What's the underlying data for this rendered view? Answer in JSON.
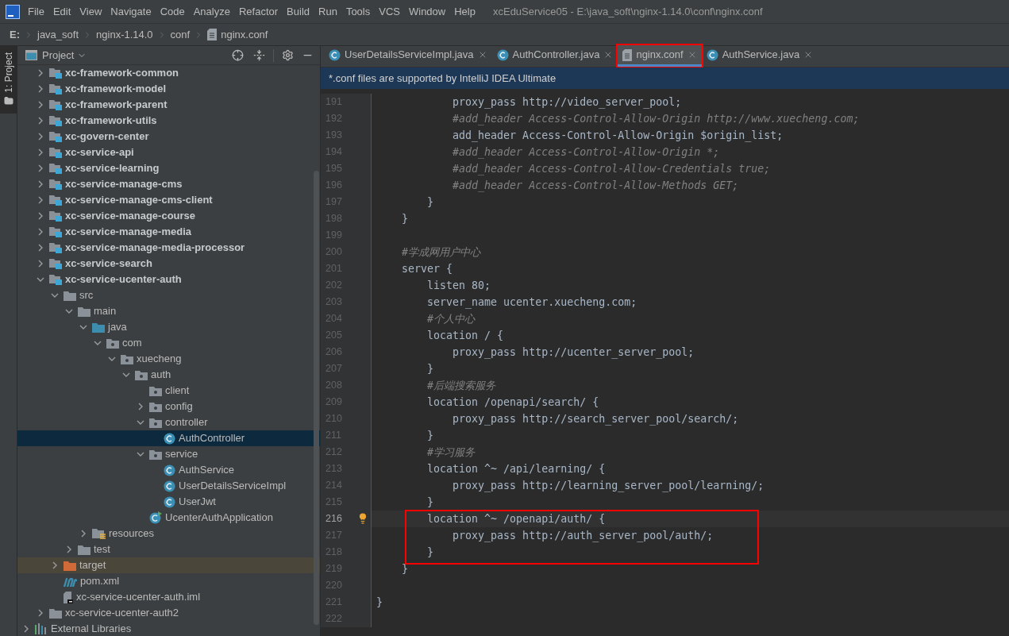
{
  "menu": {
    "items": [
      "File",
      "Edit",
      "View",
      "Navigate",
      "Code",
      "Analyze",
      "Refactor",
      "Build",
      "Run",
      "Tools",
      "VCS",
      "Window",
      "Help"
    ],
    "title": "xcEduService05 - E:\\java_soft\\nginx-1.14.0\\conf\\nginx.conf"
  },
  "breadcrumbs": [
    {
      "label": "E:",
      "kind": "drive"
    },
    {
      "label": "java_soft",
      "kind": "folder"
    },
    {
      "label": "nginx-1.14.0",
      "kind": "folder"
    },
    {
      "label": "conf",
      "kind": "folder"
    },
    {
      "label": "nginx.conf",
      "kind": "file"
    }
  ],
  "tool_strip": {
    "label": "1: Project"
  },
  "project_panel": {
    "title": "Project",
    "tree": [
      {
        "label": "xc-framework-common",
        "kind": "module",
        "expandable": true,
        "expanded": false,
        "selected": false
      },
      {
        "label": "xc-framework-model",
        "kind": "module",
        "expandable": true,
        "expanded": false,
        "selected": false
      },
      {
        "label": "xc-framework-parent",
        "kind": "module",
        "expandable": true,
        "expanded": false,
        "selected": false
      },
      {
        "label": "xc-framework-utils",
        "kind": "module",
        "expandable": true,
        "expanded": false,
        "selected": false
      },
      {
        "label": "xc-govern-center",
        "kind": "module",
        "expandable": true,
        "expanded": false,
        "selected": false
      },
      {
        "label": "xc-service-api",
        "kind": "module",
        "expandable": true,
        "expanded": false,
        "selected": false
      },
      {
        "label": "xc-service-learning",
        "kind": "module",
        "expandable": true,
        "expanded": false,
        "selected": false
      },
      {
        "label": "xc-service-manage-cms",
        "kind": "module",
        "expandable": true,
        "expanded": false,
        "selected": false
      },
      {
        "label": "xc-service-manage-cms-client",
        "kind": "module",
        "expandable": true,
        "expanded": false,
        "selected": false
      },
      {
        "label": "xc-service-manage-course",
        "kind": "module",
        "expandable": true,
        "expanded": false,
        "selected": false
      },
      {
        "label": "xc-service-manage-media",
        "kind": "module",
        "expandable": true,
        "expanded": false,
        "selected": false
      },
      {
        "label": "xc-service-manage-media-processor",
        "kind": "module",
        "expandable": true,
        "expanded": false,
        "selected": false
      },
      {
        "label": "xc-service-search",
        "kind": "module",
        "expandable": true,
        "expanded": false,
        "selected": false
      },
      {
        "label": "xc-service-ucenter-auth",
        "kind": "module",
        "expandable": true,
        "expanded": true,
        "selected": false,
        "children": [
          {
            "label": "src",
            "kind": "folder",
            "expandable": true,
            "expanded": true,
            "selected": false,
            "children": [
              {
                "label": "main",
                "kind": "folder",
                "expandable": true,
                "expanded": true,
                "selected": false,
                "children": [
                  {
                    "label": "java",
                    "kind": "source",
                    "expandable": true,
                    "expanded": true,
                    "selected": false,
                    "children": [
                      {
                        "label": "com",
                        "kind": "package",
                        "expandable": true,
                        "expanded": true,
                        "selected": false,
                        "children": [
                          {
                            "label": "xuecheng",
                            "kind": "package",
                            "expandable": true,
                            "expanded": true,
                            "selected": false,
                            "children": [
                              {
                                "label": "auth",
                                "kind": "package",
                                "expandable": true,
                                "expanded": true,
                                "selected": false,
                                "children": [
                                  {
                                    "label": "client",
                                    "kind": "package",
                                    "expandable": false,
                                    "selected": false
                                  },
                                  {
                                    "label": "config",
                                    "kind": "package",
                                    "expandable": true,
                                    "expanded": false,
                                    "selected": false
                                  },
                                  {
                                    "label": "controller",
                                    "kind": "package",
                                    "expandable": true,
                                    "expanded": true,
                                    "selected": false,
                                    "children": [
                                      {
                                        "label": "AuthController",
                                        "kind": "class",
                                        "expandable": false,
                                        "selected": true
                                      }
                                    ]
                                  },
                                  {
                                    "label": "service",
                                    "kind": "package",
                                    "expandable": true,
                                    "expanded": true,
                                    "selected": false,
                                    "children": [
                                      {
                                        "label": "AuthService",
                                        "kind": "class",
                                        "expandable": false,
                                        "selected": false
                                      },
                                      {
                                        "label": "UserDetailsServiceImpl",
                                        "kind": "class",
                                        "expandable": false,
                                        "selected": false
                                      },
                                      {
                                        "label": "UserJwt",
                                        "kind": "class",
                                        "expandable": false,
                                        "selected": false
                                      }
                                    ]
                                  },
                                  {
                                    "label": "UcenterAuthApplication",
                                    "kind": "app",
                                    "expandable": false,
                                    "selected": false
                                  }
                                ]
                              }
                            ]
                          }
                        ]
                      }
                    ]
                  },
                  {
                    "label": "resources",
                    "kind": "resources",
                    "expandable": true,
                    "expanded": false,
                    "selected": false
                  }
                ]
              },
              {
                "label": "test",
                "kind": "folder",
                "expandable": true,
                "expanded": false,
                "selected": false
              }
            ]
          },
          {
            "label": "target",
            "kind": "excluded",
            "expandable": true,
            "expanded": false,
            "selected": false
          },
          {
            "label": "pom.xml",
            "kind": "maven",
            "expandable": false,
            "selected": false
          },
          {
            "label": "xc-service-ucenter-auth.iml",
            "kind": "iml",
            "expandable": false,
            "selected": false
          }
        ]
      },
      {
        "label": "xc-service-ucenter-auth2",
        "kind": "folder",
        "expandable": true,
        "expanded": false,
        "selected": false
      }
    ],
    "root_items": [
      {
        "label": "External Libraries",
        "kind": "library",
        "expandable": true,
        "expanded": false,
        "selected": false
      }
    ]
  },
  "tabs": [
    {
      "label": "UserDetailsServiceImpl.java",
      "kind": "class",
      "selected": false,
      "marked": false
    },
    {
      "label": "AuthController.java",
      "kind": "class",
      "selected": false,
      "marked": false
    },
    {
      "label": "nginx.conf",
      "kind": "file",
      "selected": true,
      "marked": true
    },
    {
      "label": "AuthService.java",
      "kind": "class",
      "selected": false,
      "marked": false
    }
  ],
  "banner": "*.conf files are supported by IntelliJ IDEA Ultimate",
  "code": [
    {
      "number": "191",
      "text": "            proxy_pass http://video_server_pool;",
      "kind": "code",
      "current": false,
      "marked": false
    },
    {
      "number": "192",
      "text": "            #add_header Access-Control-Allow-Origin http://www.xuecheng.com;",
      "kind": "comment",
      "current": false,
      "marked": false
    },
    {
      "number": "193",
      "text": "            add_header Access-Control-Allow-Origin $origin_list;",
      "kind": "code",
      "current": false,
      "marked": false
    },
    {
      "number": "194",
      "text": "            #add_header Access-Control-Allow-Origin *;",
      "kind": "comment",
      "current": false,
      "marked": false
    },
    {
      "number": "195",
      "text": "            #add_header Access-Control-Allow-Credentials true;",
      "kind": "comment",
      "current": false,
      "marked": false
    },
    {
      "number": "196",
      "text": "            #add_header Access-Control-Allow-Methods GET;",
      "kind": "comment",
      "current": false,
      "marked": false
    },
    {
      "number": "197",
      "text": "        }",
      "kind": "code",
      "current": false,
      "marked": false
    },
    {
      "number": "198",
      "text": "    }",
      "kind": "code",
      "current": false,
      "marked": false
    },
    {
      "number": "199",
      "current": false,
      "marked": false
    },
    {
      "number": "200",
      "text": "    #学成网用户中心",
      "kind": "comment",
      "current": false,
      "marked": false
    },
    {
      "number": "201",
      "text": "    server {",
      "kind": "code",
      "current": false,
      "marked": false
    },
    {
      "number": "202",
      "text": "        listen 80;",
      "kind": "code",
      "current": false,
      "marked": false
    },
    {
      "number": "203",
      "text": "        server_name ucenter.xuecheng.com;",
      "kind": "code",
      "current": false,
      "marked": false
    },
    {
      "number": "204",
      "text": "        #个人中心",
      "kind": "comment",
      "current": false,
      "marked": false
    },
    {
      "number": "205",
      "text": "        location / {",
      "kind": "code",
      "current": false,
      "marked": false
    },
    {
      "number": "206",
      "text": "            proxy_pass http://ucenter_server_pool;",
      "kind": "code",
      "current": false,
      "marked": false
    },
    {
      "number": "207",
      "text": "        }",
      "kind": "code",
      "current": false,
      "marked": false
    },
    {
      "number": "208",
      "text": "        #后端搜索服务",
      "kind": "comment",
      "current": false,
      "marked": false
    },
    {
      "number": "209",
      "text": "        location /openapi/search/ {",
      "kind": "code",
      "current": false,
      "marked": false
    },
    {
      "number": "210",
      "text": "            proxy_pass http://search_server_pool/search/;",
      "kind": "code",
      "current": false,
      "marked": false
    },
    {
      "number": "211",
      "text": "        }",
      "kind": "code",
      "current": false,
      "marked": false
    },
    {
      "number": "212",
      "text": "        #学习服务",
      "kind": "comment",
      "current": false,
      "marked": false
    },
    {
      "number": "213",
      "text": "        location ^~ /api/learning/ {",
      "kind": "code",
      "current": false,
      "marked": false
    },
    {
      "number": "214",
      "text": "            proxy_pass http://learning_server_pool/learning/;",
      "kind": "code",
      "current": false,
      "marked": false
    },
    {
      "number": "215",
      "text": "        }",
      "kind": "code",
      "current": false,
      "marked": false
    },
    {
      "number": "216",
      "text": "        location ^~ /openapi/auth/ {",
      "kind": "code",
      "current": true,
      "marked": true
    },
    {
      "number": "217",
      "text": "            proxy_pass http://auth_server_pool/auth/;",
      "kind": "code",
      "current": false,
      "marked": true
    },
    {
      "number": "218",
      "text": "        }",
      "kind": "code",
      "current": false,
      "marked": true
    },
    {
      "number": "219",
      "text": "    }",
      "kind": "code",
      "current": false,
      "marked": false
    },
    {
      "number": "220",
      "current": false,
      "marked": false
    },
    {
      "number": "221",
      "text": "}",
      "kind": "code",
      "current": false,
      "marked": false
    },
    {
      "number": "222",
      "current": false,
      "marked": false
    }
  ]
}
